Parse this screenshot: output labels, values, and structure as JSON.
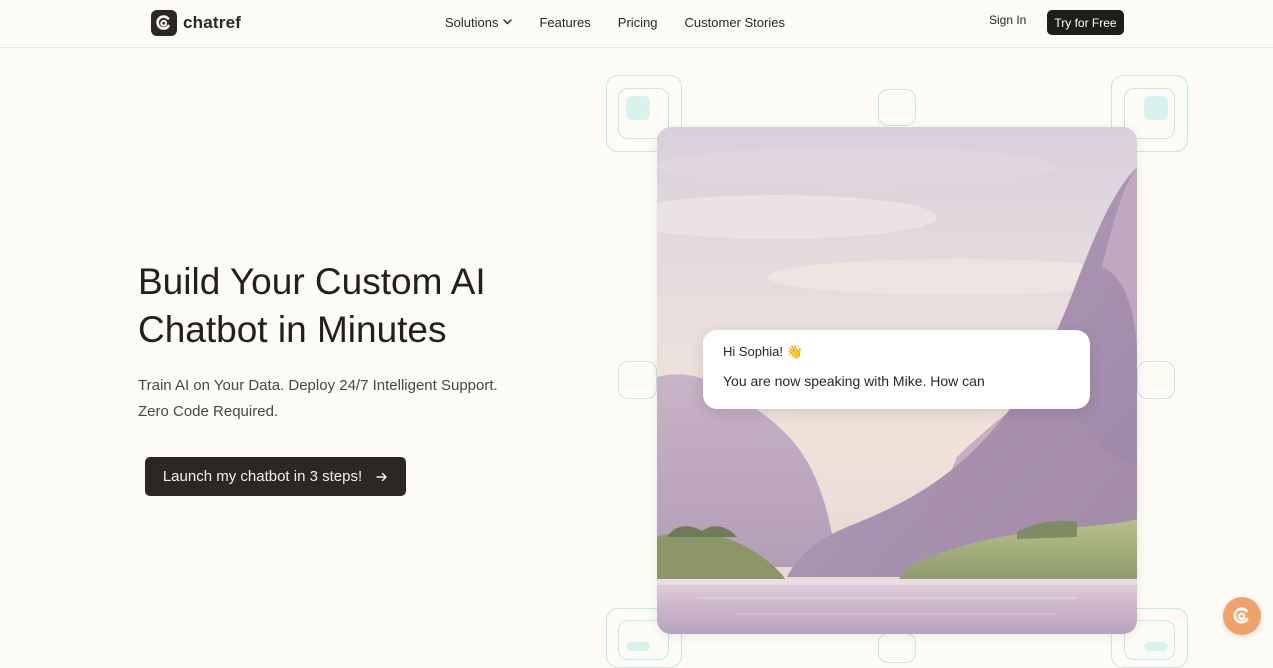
{
  "brand": {
    "name": "chatref",
    "logo_icon": "chatref-logo-icon"
  },
  "nav": {
    "links": [
      {
        "label": "Solutions",
        "has_dropdown": true
      },
      {
        "label": "Features"
      },
      {
        "label": "Pricing"
      },
      {
        "label": "Customer Stories"
      }
    ],
    "sign_in": "Sign In",
    "try_free": "Try for Free"
  },
  "hero": {
    "title_line1": "Build Your Custom AI",
    "title_line2": "Chatbot in Minutes",
    "subtitle_line1": "Train AI on Your Data. Deploy 24/7 Intelligent Support.",
    "subtitle_line2": "Zero Code Required.",
    "cta_label": "Launch my chatbot in 3 steps!",
    "cta_icon": "arrow-right-icon"
  },
  "chat_preview": {
    "greeting": "Hi Sophia! 👋",
    "message": "You are now speaking with Mike. How can"
  },
  "colors": {
    "background": "#fcfbf5",
    "primary_dark": "#1f1d1a",
    "accent_teal": "#bfe9e2",
    "help_button": "#f0a268"
  }
}
